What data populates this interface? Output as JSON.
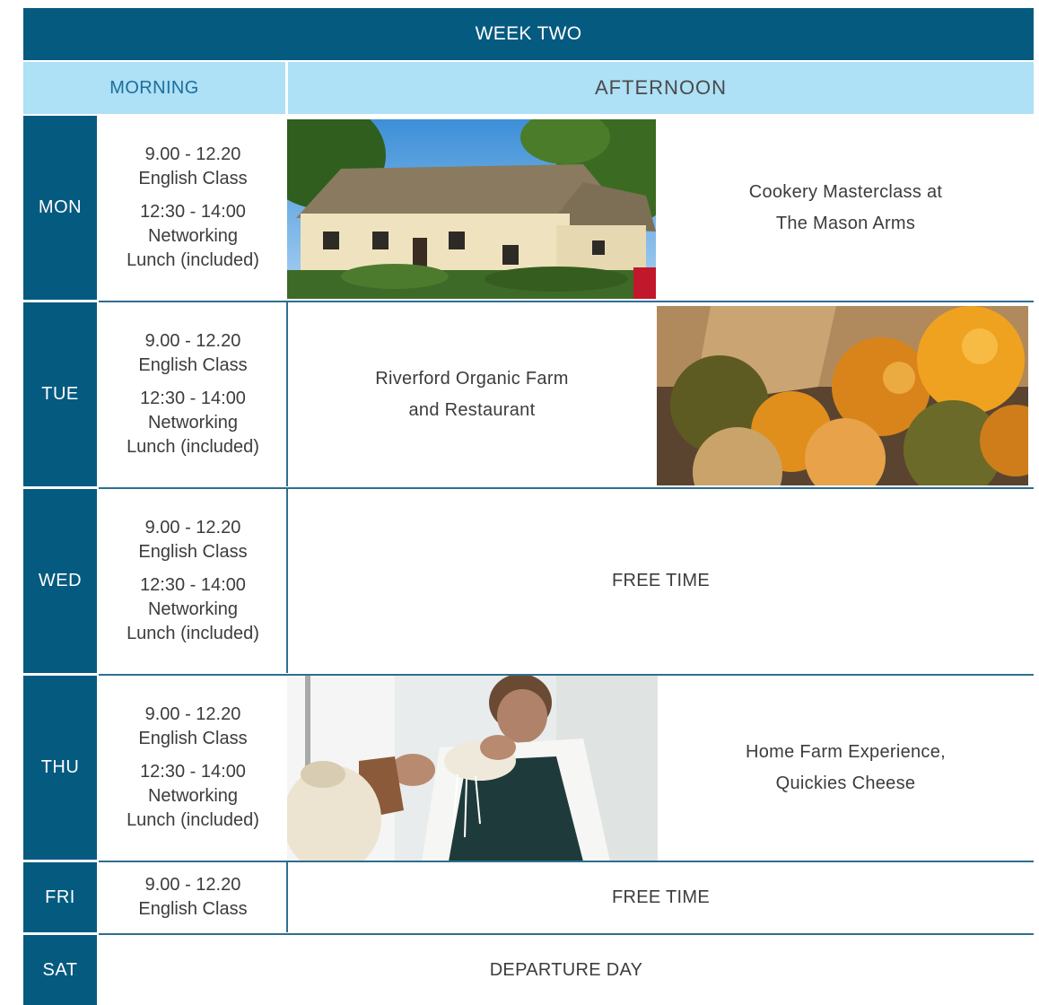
{
  "week_title": "WEEK TWO",
  "columns": {
    "morning": "MORNING",
    "afternoon": "AFTERNOON"
  },
  "days": [
    {
      "day": "MON",
      "morning": [
        "9.00 - 12.20",
        "English Class",
        "12:30 - 14:00",
        "Networking",
        "Lunch (included)"
      ],
      "afternoon": [
        "Cookery Masterclass at",
        "The Mason Arms"
      ],
      "photo": "thatched-pub-photo"
    },
    {
      "day": "TUE",
      "morning": [
        "9.00 - 12.20",
        "English Class",
        "12:30 - 14:00",
        "Networking",
        "Lunch (included)"
      ],
      "afternoon": [
        "Riverford Organic Farm",
        "and Restaurant"
      ],
      "photo": "apples-photo"
    },
    {
      "day": "WED",
      "morning": [
        "9.00 - 12.20",
        "English Class",
        "12:30 - 14:00",
        "Networking",
        "Lunch (included)"
      ],
      "afternoon": [
        "FREE TIME"
      ]
    },
    {
      "day": "THU",
      "morning": [
        "9.00 - 12.20",
        "English Class",
        "12:30 - 14:00",
        "Networking",
        "Lunch (included)"
      ],
      "afternoon": [
        "Home Farm Experience,",
        "Quickies Cheese"
      ],
      "photo": "cheesemaker-photo"
    },
    {
      "day": "FRI",
      "morning": [
        "9.00 - 12.20",
        "English Class"
      ],
      "afternoon": [
        "FREE TIME"
      ]
    },
    {
      "day": "SAT",
      "afternoon": [
        "DEPARTURE DAY"
      ]
    }
  ],
  "colors": {
    "header_dark": "#055a80",
    "header_light": "#aee0f6",
    "morning_label": "#1d6e9a",
    "divider": "#2e6e90"
  }
}
